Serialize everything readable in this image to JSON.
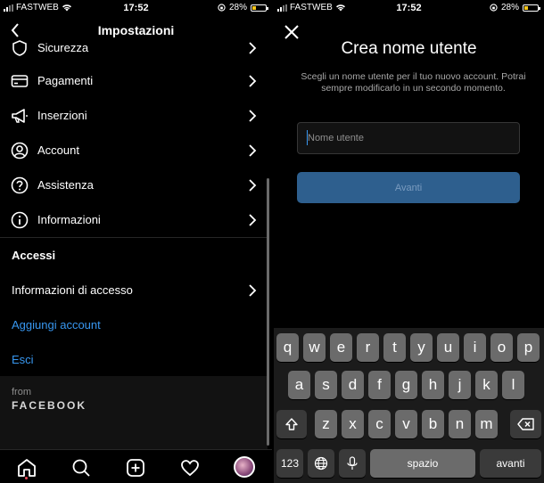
{
  "status_left": {
    "carrier": "FASTWEB",
    "time": "17:52",
    "battery": "28%",
    "battery_level": 0.28
  },
  "status_right": {
    "carrier": "FASTWEB",
    "time": "17:52",
    "battery": "28%",
    "battery_level": 0.28
  },
  "settings": {
    "title": "Impostazioni",
    "items": [
      {
        "label": "Sicurezza",
        "icon": "shield-icon"
      },
      {
        "label": "Pagamenti",
        "icon": "card-icon"
      },
      {
        "label": "Inserzioni",
        "icon": "megaphone-icon"
      },
      {
        "label": "Account",
        "icon": "account-icon"
      },
      {
        "label": "Assistenza",
        "icon": "help-icon"
      },
      {
        "label": "Informazioni",
        "icon": "info-icon"
      }
    ],
    "accessi_title": "Accessi",
    "login_info": "Informazioni di accesso",
    "add_account": "Aggiungi account",
    "logout": "Esci",
    "from": "from",
    "facebook": "FACEBOOK"
  },
  "tabbar": [
    "home-icon",
    "search-icon",
    "add-icon",
    "heart-icon",
    "profile-avatar"
  ],
  "create": {
    "title": "Crea nome utente",
    "subtitle": "Scegli un nome utente per il tuo nuovo account. Potrai sempre modificarlo in un secondo momento.",
    "placeholder": "Nome utente",
    "next": "Avanti"
  },
  "keyboard": {
    "row1": [
      "q",
      "w",
      "e",
      "r",
      "t",
      "y",
      "u",
      "i",
      "o",
      "p"
    ],
    "row2": [
      "a",
      "s",
      "d",
      "f",
      "g",
      "h",
      "j",
      "k",
      "l"
    ],
    "row3": [
      "z",
      "x",
      "c",
      "v",
      "b",
      "n",
      "m"
    ],
    "numbers": "123",
    "space": "spazio",
    "return": "avanti"
  },
  "colors": {
    "link": "#3897f0",
    "button": "#2e5f8e",
    "background": "#000000"
  }
}
